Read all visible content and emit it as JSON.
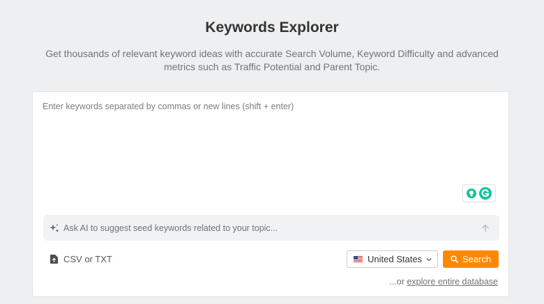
{
  "header": {
    "title": "Keywords Explorer",
    "subtitle": "Get thousands of relevant keyword ideas with accurate Search Volume, Keyword Difficulty and advanced metrics such as Traffic Potential and Parent Topic."
  },
  "keywords_input": {
    "value": "",
    "placeholder": "Enter keywords separated by commas or new lines (shift + enter)"
  },
  "grammarly": {
    "icons": [
      "lightbulb-icon",
      "grammarly-g-icon"
    ],
    "color": "#15c39a"
  },
  "ai_prompt": {
    "icon": "sparkle-icon",
    "value": "",
    "placeholder": "Ask AI to suggest seed keywords related to your topic...",
    "submit_icon": "arrow-up-icon"
  },
  "upload": {
    "icon": "file-upload-icon",
    "label": "CSV or TXT"
  },
  "country": {
    "icon": "us-flag-icon",
    "selected": "United States",
    "chevron_icon": "chevron-down-icon"
  },
  "search": {
    "icon": "search-icon",
    "label": "Search",
    "color": "#ff8800"
  },
  "explore": {
    "prefix": "...or ",
    "link_text": "explore entire database"
  }
}
